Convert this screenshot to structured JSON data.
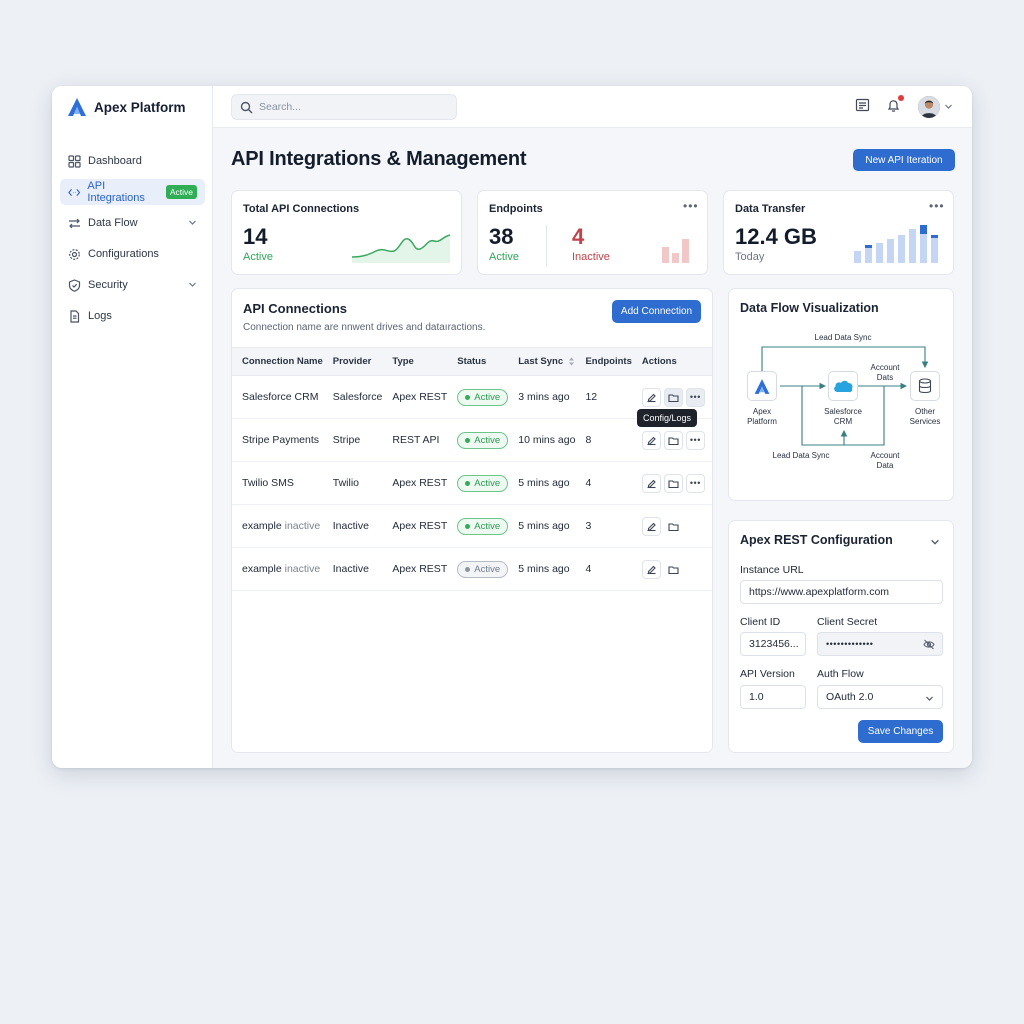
{
  "app": {
    "name": "Apex Platform"
  },
  "sidebar": {
    "items": [
      {
        "label": "Dashboard",
        "icon": "grid-icon"
      },
      {
        "label": "API Integrations",
        "icon": "code-icon",
        "badge": "Active",
        "active": true
      },
      {
        "label": "Data Flow",
        "icon": "arrows-icon",
        "expandable": true
      },
      {
        "label": "Configurations",
        "icon": "gear-icon"
      },
      {
        "label": "Security",
        "icon": "shield-icon",
        "expandable": true
      },
      {
        "label": "Logs",
        "icon": "document-icon"
      }
    ]
  },
  "topbar": {
    "search_placeholder": "Search..."
  },
  "page": {
    "title": "API Integrations & Management",
    "new_button": "New API Iteration"
  },
  "stats": {
    "total": {
      "title": "Total API Connections",
      "value": "14",
      "sub": "Active"
    },
    "endpoints": {
      "title": "Endpoints",
      "active_value": "38",
      "active_label": "Active",
      "inactive_value": "4",
      "inactive_label": "Inactive"
    },
    "transfer": {
      "title": "Data Transfer",
      "value": "12.4 GB",
      "sub": "Today"
    }
  },
  "connections": {
    "title": "API Connections",
    "subtitle": "Connection name are nnwent drives and dataıractions.",
    "add_button": "Add Connection",
    "columns": [
      "Connection Name",
      "Provider",
      "Type",
      "Status",
      "Last Sync",
      "Endpoints",
      "Actions"
    ],
    "rows": [
      {
        "name": "Salesforce CRM",
        "provider": "Salesforce",
        "type": "Apex REST",
        "status": "Active",
        "active": true,
        "sync": "3 mins ago",
        "endpoints": "12"
      },
      {
        "name": "Stripe Payments",
        "provider": "Stripe",
        "type": "REST API",
        "status": "Active",
        "active": true,
        "sync": "10 mins ago",
        "endpoints": "8"
      },
      {
        "name": "Twilio SMS",
        "provider": "Twilio",
        "type": "Apex REST",
        "status": "Active",
        "active": true,
        "sync": "5 mins ago",
        "endpoints": "4"
      },
      {
        "name": "example",
        "name_suffix": "inactive",
        "provider": "Inactive",
        "type": "Apex REST",
        "status": "Active",
        "active": true,
        "sync": "5 mins ago",
        "endpoints": "3"
      },
      {
        "name": "example",
        "name_suffix": "inactive",
        "provider": "Inactive",
        "type": "Apex REST",
        "status": "Active",
        "active": false,
        "sync": "5 mins ago",
        "endpoints": "4"
      }
    ],
    "tooltip": "Config/Logs"
  },
  "flow": {
    "title": "Data Flow Visualization",
    "top_label": "Lead Data Sync",
    "bottom_label": "Lead Data Sync",
    "account_top": "Account\nDats",
    "account_bottom": "Account\nData",
    "nodes": {
      "apex": "Apex\nPlatform",
      "salesforce": "Salesforce\nCRM",
      "other": "Other\nServices"
    }
  },
  "config": {
    "title": "Apex REST Configuration",
    "instance_label": "Instance URL",
    "instance_value": "https://www.apexplatform.com",
    "client_id_label": "Client ID",
    "client_id_value": "3123456...",
    "client_secret_label": "Client Secret",
    "client_secret_value": "•••••••••••••",
    "api_version_label": "API Version",
    "api_version_value": "1.0",
    "auth_flow_label": "Auth Flow",
    "auth_flow_value": "OAuth 2.0",
    "save_button": "Save Changes"
  },
  "colors": {
    "accent": "#2e6ccf",
    "success": "#2fae55",
    "danger": "#c0444a"
  }
}
